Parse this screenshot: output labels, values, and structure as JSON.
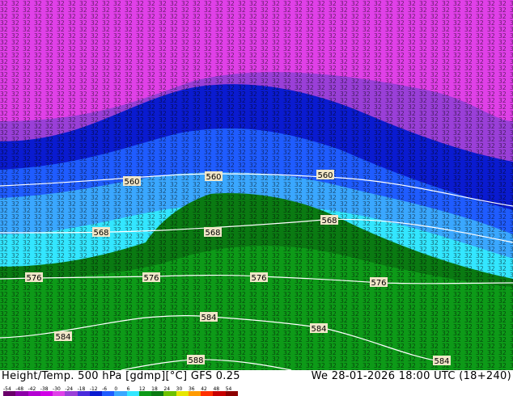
{
  "map": {
    "contour_labels": [
      "560",
      "560",
      "560",
      "568",
      "568",
      "568",
      "576",
      "576",
      "576",
      "576",
      "584",
      "584",
      "584",
      "584",
      "588"
    ],
    "colors": {
      "magenta": "#e040e8",
      "violet": "#9a3fd8",
      "deep_blue": "#0a1bd0",
      "blue": "#1f5cff",
      "sky": "#3aa7ff",
      "cyan": "#33e6ff",
      "dark_green": "#0a7a12",
      "green": "#0d9a18",
      "contour_line": "#ffffff",
      "label_bg": "#f0e6c8"
    }
  },
  "footer": {
    "title": "Height/Temp. 500 hPa [gdmp][°C] GFS 0.25",
    "valid": "We 28-01-2026 18:00 UTC (18+240)"
  },
  "legend": {
    "ticks": [
      "-54",
      "-48",
      "-42",
      "-38",
      "-30",
      "-24",
      "-18",
      "-12",
      "-6",
      "0",
      "6",
      "12",
      "18",
      "24",
      "30",
      "36",
      "42",
      "48",
      "54"
    ],
    "colors": [
      "#6a006a",
      "#8c00a8",
      "#b400d2",
      "#d000e6",
      "#e040e8",
      "#9a3fd8",
      "#4a2adc",
      "#0a1bd0",
      "#1f5cff",
      "#3aa7ff",
      "#33e6ff",
      "#0d9a18",
      "#0a7a12",
      "#6cc000",
      "#e6e600",
      "#ff9a00",
      "#ff3000",
      "#c80000",
      "#8c0000"
    ]
  }
}
